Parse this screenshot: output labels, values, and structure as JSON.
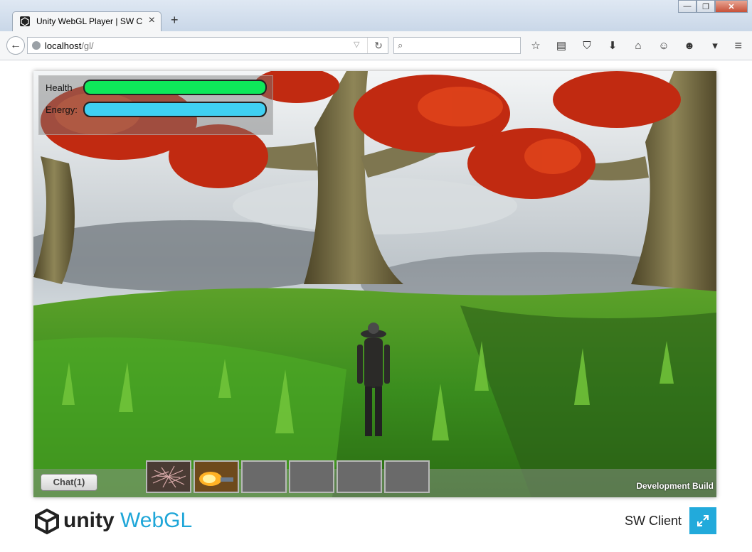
{
  "browser": {
    "tab_title": "Unity WebGL Player | SW C...",
    "tab_close": "×",
    "new_tab": "+",
    "url_host": "localhost",
    "url_path": "/gl/",
    "search_placeholder": "",
    "window_buttons": [
      "—",
      "❐",
      "✕"
    ],
    "toolbar_icons": [
      "star-icon",
      "reading-list-icon",
      "pocket-icon",
      "download-icon",
      "home-icon",
      "chat-icon",
      "addon-icon"
    ]
  },
  "game": {
    "hud": {
      "health_label": "Health",
      "energy_label": "Energy:",
      "health_level": 1.0,
      "energy_level": 1.0,
      "health_color": "#0ee85a",
      "energy_color": "#3fd0f2"
    },
    "chat_button": "Chat(1)",
    "inventory_slots": [
      {
        "item": "twig-bundle"
      },
      {
        "item": "fire-torch"
      },
      {
        "item": ""
      },
      {
        "item": ""
      },
      {
        "item": ""
      },
      {
        "item": ""
      }
    ],
    "build_label": "Development Build"
  },
  "footer": {
    "logo_unity": "unity",
    "logo_webgl": "WebGL",
    "app_title": "SW Client",
    "accent": "#22aadb"
  }
}
